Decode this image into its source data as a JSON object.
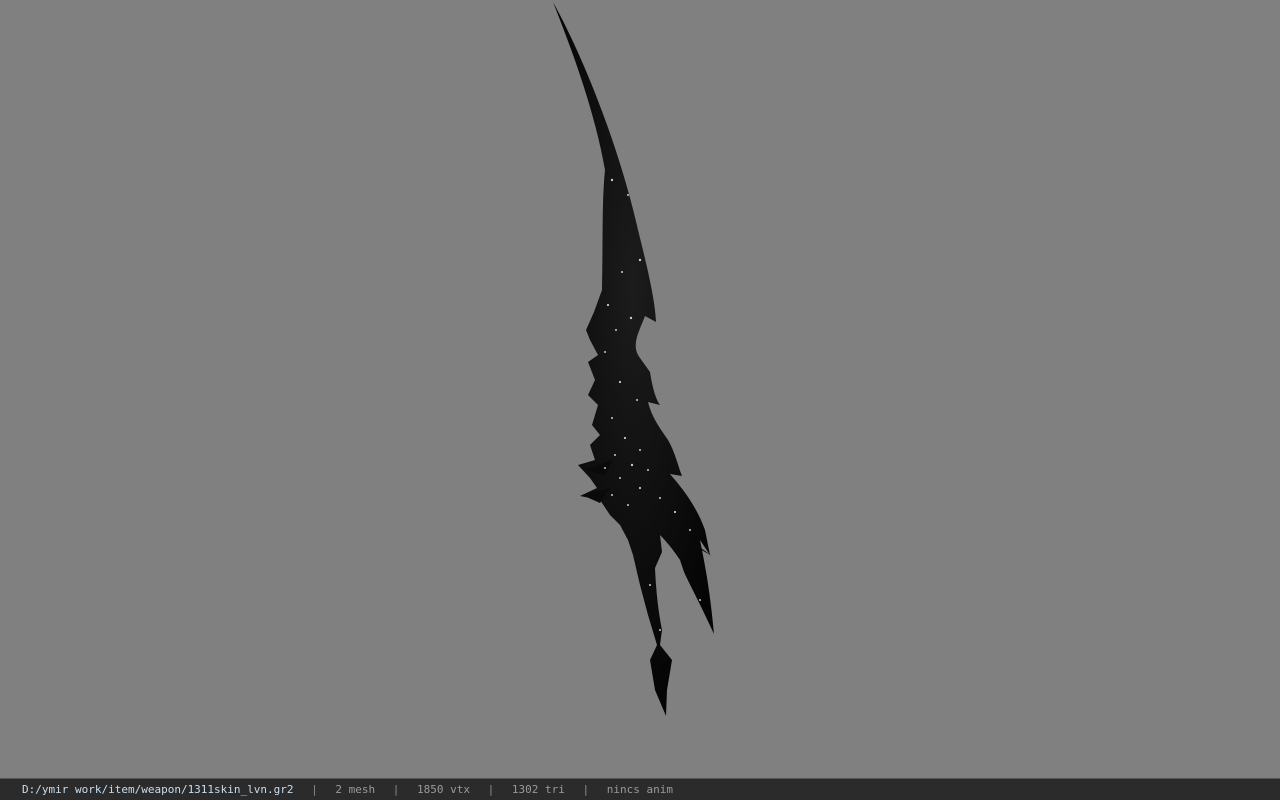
{
  "viewport": {
    "background": "#808080",
    "model_color": "#0a0a0a"
  },
  "statusbar": {
    "path": "D:/ymir work/item/weapon/1311skin_lvn.gr2",
    "separator": "|",
    "mesh": "2 mesh",
    "vtx": "1850 vtx",
    "tri": "1302 tri",
    "anim": "nincs anim"
  }
}
